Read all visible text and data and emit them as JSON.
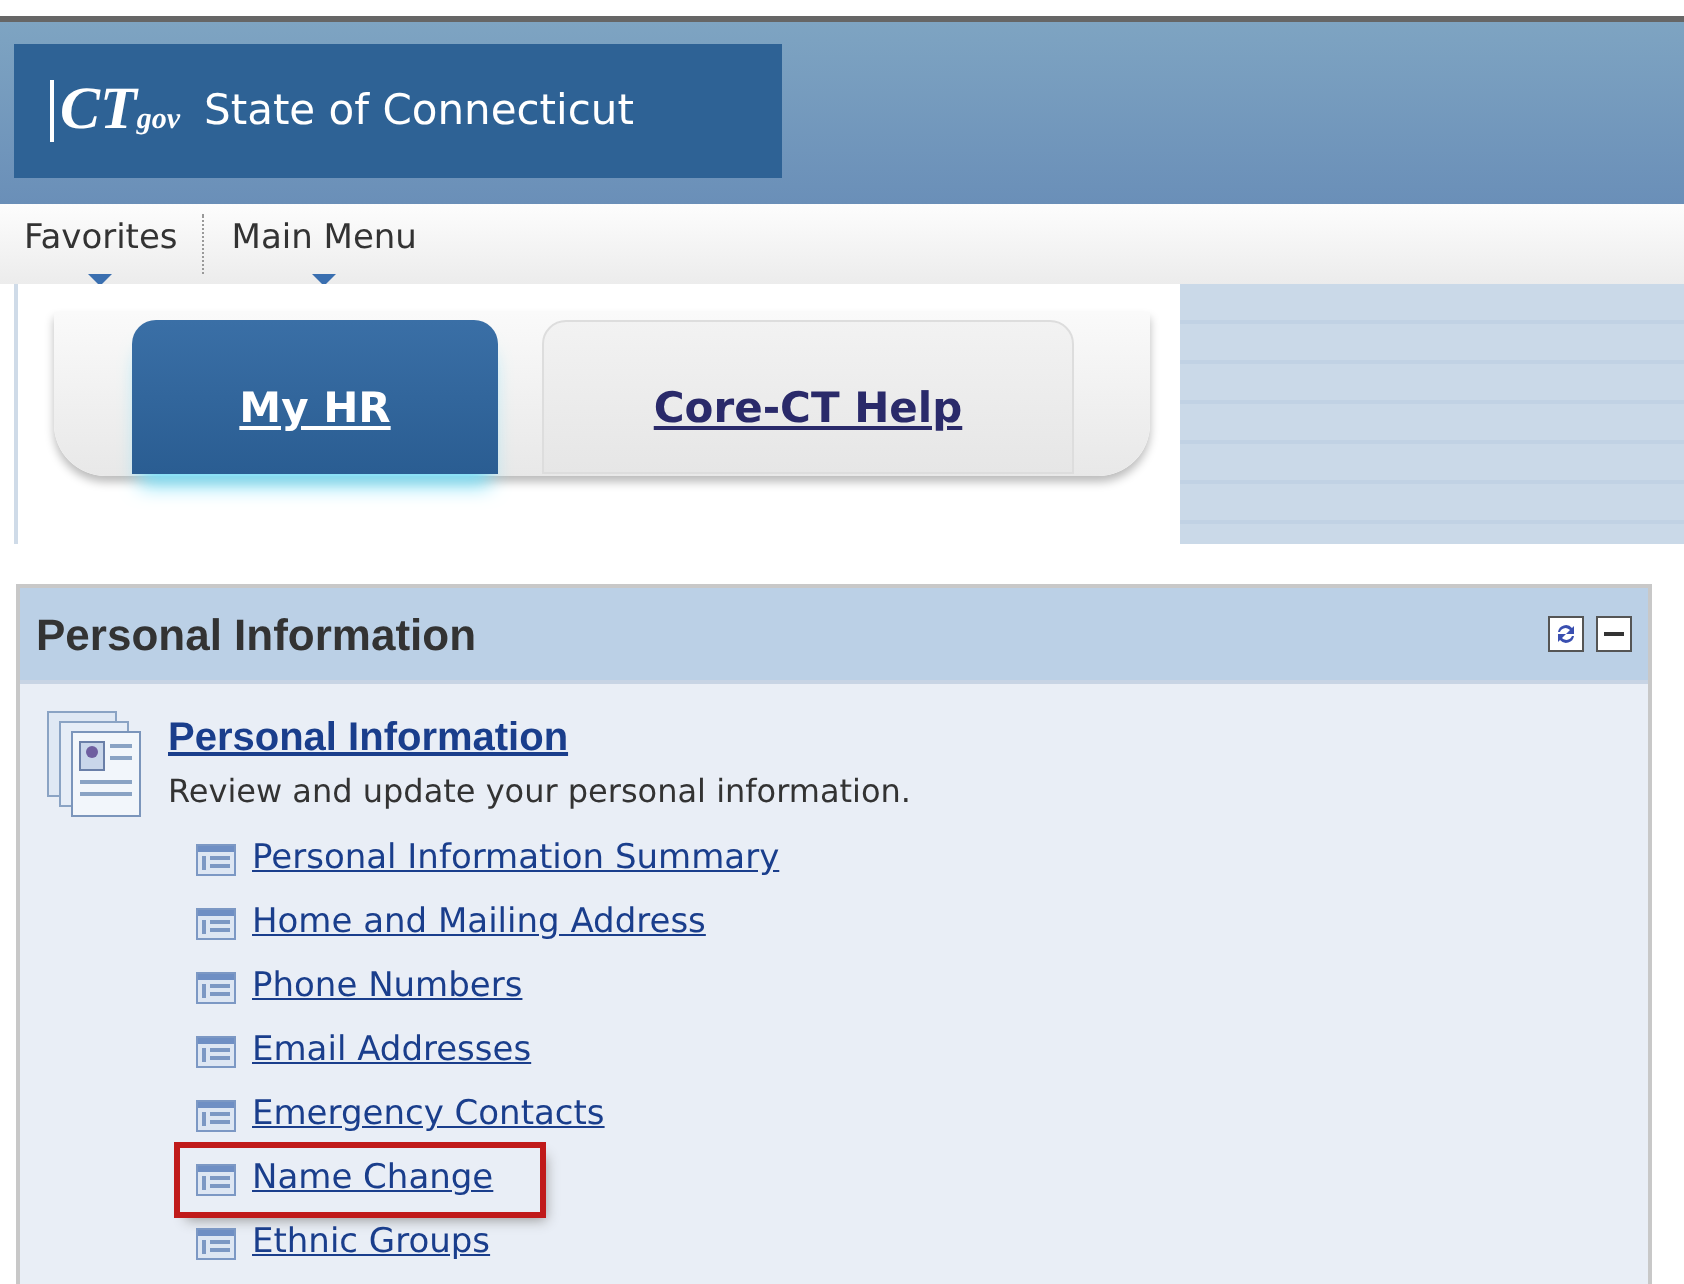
{
  "header": {
    "logo_main": "CT",
    "logo_sub": "gov",
    "title": "State of Connecticut"
  },
  "menu": [
    {
      "label": "Favorites"
    },
    {
      "label": "Main Menu"
    }
  ],
  "tabs": [
    {
      "label": "My HR",
      "selected": true
    },
    {
      "label": "Core-CT Help",
      "selected": false
    }
  ],
  "portlet": {
    "title": "Personal Information",
    "section": {
      "title": "Personal Information",
      "description": "Review and update your personal information."
    },
    "links": [
      {
        "label": "Personal Information Summary",
        "highlighted": false
      },
      {
        "label": "Home and Mailing Address",
        "highlighted": false
      },
      {
        "label": "Phone Numbers",
        "highlighted": false
      },
      {
        "label": "Email Addresses",
        "highlighted": false
      },
      {
        "label": "Emergency Contacts",
        "highlighted": false
      },
      {
        "label": "Name Change",
        "highlighted": true
      },
      {
        "label": "Ethnic Groups",
        "highlighted": false
      }
    ]
  }
}
